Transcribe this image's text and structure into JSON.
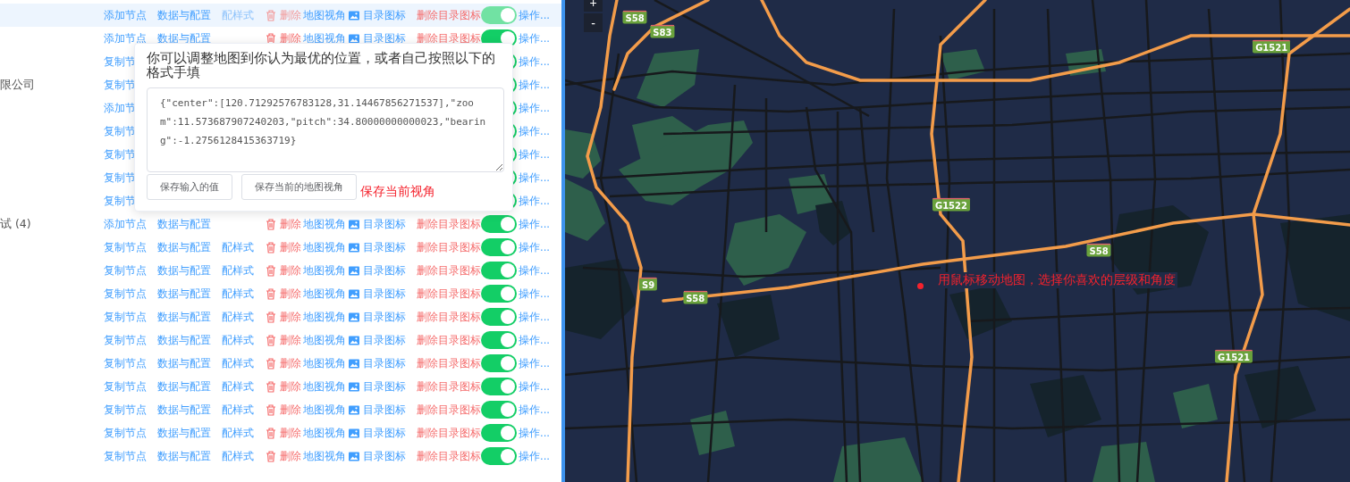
{
  "table": {
    "rows": [
      {
        "hovered": true,
        "action": "添加节点",
        "data": "数据与配置",
        "style": "配样式",
        "delete": "删除",
        "view": "地图视角",
        "icon": "目录图标",
        "delete_icon": "删除目录图标",
        "enabled": true,
        "more": "操作..."
      },
      {
        "hovered": false,
        "action": "添加节点",
        "data": "数据与配置",
        "delete": "删除",
        "view": "地图视角",
        "icon": "目录图标",
        "delete_icon": "删除目录图标",
        "enabled": true,
        "more": "操作..."
      },
      {
        "hovered": false,
        "action": "复制节",
        "enabled": true,
        "more": "操作..."
      },
      {
        "hovered": false,
        "label": "限公司",
        "action": "复制节",
        "enabled": true,
        "more": "操作..."
      },
      {
        "hovered": false,
        "action": "添加节",
        "enabled": true,
        "more": "操作..."
      },
      {
        "hovered": false,
        "action": "复制节",
        "enabled": true,
        "more": "操作..."
      },
      {
        "hovered": false,
        "action": "复制节",
        "enabled": true,
        "more": "操作..."
      },
      {
        "hovered": false,
        "action": "复制节",
        "enabled": true,
        "more": "操作..."
      },
      {
        "hovered": false,
        "action": "复制节",
        "enabled": true,
        "more": "操作..."
      },
      {
        "hovered": false,
        "label": "试 (4)",
        "action": "添加节点",
        "data": "数据与配置",
        "delete": "删除",
        "view": "地图视角",
        "icon": "目录图标",
        "delete_icon": "删除目录图标",
        "enabled": true,
        "more": "操作..."
      },
      {
        "hovered": false,
        "action": "复制节点",
        "data": "数据与配置",
        "style": "配样式",
        "delete": "删除",
        "view": "地图视角",
        "icon": "目录图标",
        "delete_icon": "删除目录图标",
        "enabled": true,
        "more": "操作..."
      },
      {
        "hovered": false,
        "action": "复制节点",
        "data": "数据与配置",
        "style": "配样式",
        "delete": "删除",
        "view": "地图视角",
        "icon": "目录图标",
        "delete_icon": "删除目录图标",
        "enabled": true,
        "more": "操作..."
      },
      {
        "hovered": false,
        "action": "复制节点",
        "data": "数据与配置",
        "style": "配样式",
        "delete": "删除",
        "view": "地图视角",
        "icon": "目录图标",
        "delete_icon": "删除目录图标",
        "enabled": true,
        "more": "操作..."
      },
      {
        "hovered": false,
        "action": "复制节点",
        "data": "数据与配置",
        "style": "配样式",
        "delete": "删除",
        "view": "地图视角",
        "icon": "目录图标",
        "delete_icon": "删除目录图标",
        "enabled": true,
        "more": "操作..."
      },
      {
        "hovered": false,
        "action": "复制节点",
        "data": "数据与配置",
        "style": "配样式",
        "delete": "删除",
        "view": "地图视角",
        "icon": "目录图标",
        "delete_icon": "删除目录图标",
        "enabled": true,
        "more": "操作..."
      },
      {
        "hovered": false,
        "action": "复制节点",
        "data": "数据与配置",
        "style": "配样式",
        "delete": "删除",
        "view": "地图视角",
        "icon": "目录图标",
        "delete_icon": "删除目录图标",
        "enabled": true,
        "more": "操作..."
      },
      {
        "hovered": false,
        "action": "复制节点",
        "data": "数据与配置",
        "style": "配样式",
        "delete": "删除",
        "view": "地图视角",
        "icon": "目录图标",
        "delete_icon": "删除目录图标",
        "enabled": true,
        "more": "操作..."
      },
      {
        "hovered": false,
        "action": "复制节点",
        "data": "数据与配置",
        "style": "配样式",
        "delete": "删除",
        "view": "地图视角",
        "icon": "目录图标",
        "delete_icon": "删除目录图标",
        "enabled": true,
        "more": "操作..."
      },
      {
        "hovered": false,
        "action": "复制节点",
        "data": "数据与配置",
        "style": "配样式",
        "delete": "删除",
        "view": "地图视角",
        "icon": "目录图标",
        "delete_icon": "删除目录图标",
        "enabled": true,
        "more": "操作..."
      },
      {
        "hovered": false,
        "action": "复制节点",
        "data": "数据与配置",
        "style": "配样式",
        "delete": "删除",
        "view": "地图视角",
        "icon": "目录图标",
        "delete_icon": "删除目录图标",
        "enabled": true,
        "more": "操作..."
      }
    ]
  },
  "popover": {
    "title": "你可以调整地图到你认为最优的位置，或者自己按照以下的格式手填",
    "value": "{\"center\":[120.71292576783128,31.14467856271537],\"zoom\":11.573687907240203,\"pitch\":34.80000000000023,\"bearing\":-1.2756128415363719}",
    "buttons": [
      "保存输入的值",
      "保存当前的地图视角"
    ],
    "note": "保存当前视角"
  },
  "map": {
    "zoom_buttons": [
      "+",
      "-"
    ],
    "shields": [
      {
        "label": "S58"
      },
      {
        "label": "S83"
      },
      {
        "label": "G1521"
      },
      {
        "label": "G1522"
      },
      {
        "label": "S58"
      },
      {
        "label": "S9"
      },
      {
        "label": "S58"
      },
      {
        "label": "G1521"
      }
    ],
    "hint": "用鼠标移动地图，选择你喜欢的层级和角度"
  }
}
